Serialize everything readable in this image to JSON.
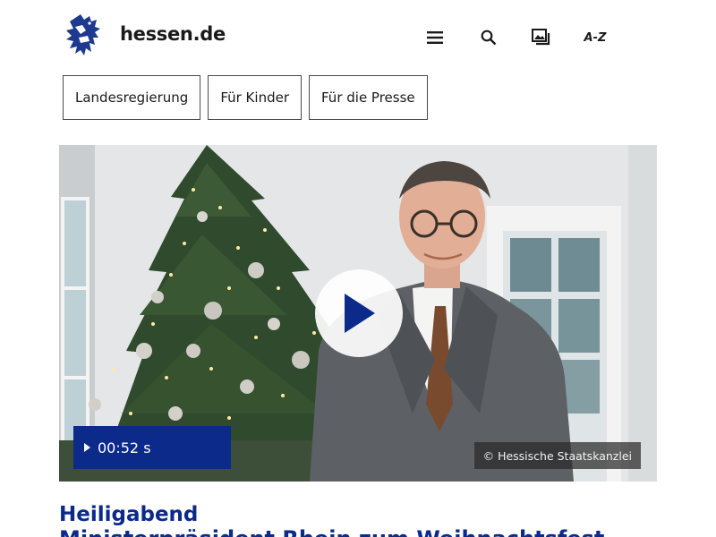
{
  "header": {
    "site_name": "hessen.de",
    "icons": [
      "menu-icon",
      "search-icon",
      "media-icon"
    ],
    "az_label": "A-Z"
  },
  "quick_links": [
    "Landesregierung",
    "Für Kinder",
    "Für die Presse"
  ],
  "hero": {
    "duration": "00:52 s",
    "credit": "© Hessische Staatskanzlei"
  },
  "article": {
    "kicker": "Heiligabend",
    "headline": "Ministerpräsident Rhein zum Weihnachtsfest"
  },
  "colors": {
    "brand_blue": "#0b2a8a",
    "text": "#1a1a1a",
    "border": "#4a4a4a"
  }
}
